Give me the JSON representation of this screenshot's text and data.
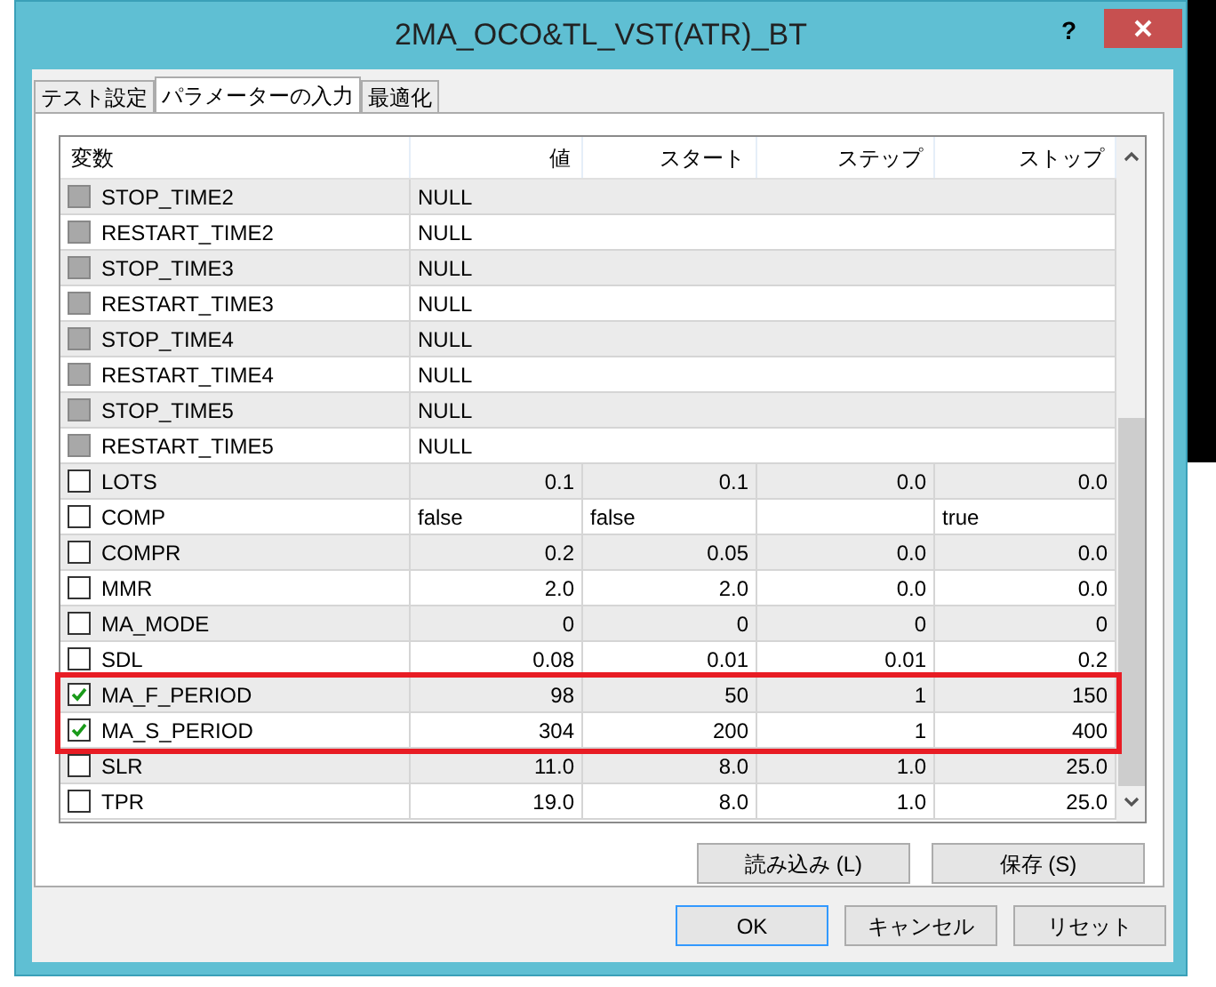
{
  "window": {
    "title": "2MA_OCO&TL_VST(ATR)_BT",
    "help": "?"
  },
  "tabs": [
    {
      "label": "テスト設定",
      "selected": false
    },
    {
      "label": "パラメーターの入力",
      "selected": true
    },
    {
      "label": "最適化",
      "selected": false
    }
  ],
  "table": {
    "columns": [
      "変数",
      "値",
      "スタート",
      "ステップ",
      "ストップ"
    ],
    "rows": [
      {
        "kind": "string",
        "name": "STOP_TIME2",
        "value": "NULL",
        "checked": false,
        "disabled": true,
        "highlighted": false
      },
      {
        "kind": "string",
        "name": "RESTART_TIME2",
        "value": "NULL",
        "checked": false,
        "disabled": true,
        "highlighted": false
      },
      {
        "kind": "string",
        "name": "STOP_TIME3",
        "value": "NULL",
        "checked": false,
        "disabled": true,
        "highlighted": false
      },
      {
        "kind": "string",
        "name": "RESTART_TIME3",
        "value": "NULL",
        "checked": false,
        "disabled": true,
        "highlighted": false
      },
      {
        "kind": "string",
        "name": "STOP_TIME4",
        "value": "NULL",
        "checked": false,
        "disabled": true,
        "highlighted": false
      },
      {
        "kind": "string",
        "name": "RESTART_TIME4",
        "value": "NULL",
        "checked": false,
        "disabled": true,
        "highlighted": false
      },
      {
        "kind": "string",
        "name": "STOP_TIME5",
        "value": "NULL",
        "checked": false,
        "disabled": true,
        "highlighted": false
      },
      {
        "kind": "string",
        "name": "RESTART_TIME5",
        "value": "NULL",
        "checked": false,
        "disabled": true,
        "highlighted": false
      },
      {
        "kind": "number",
        "name": "LOTS",
        "value": "0.1",
        "start": "0.1",
        "step": "0.0",
        "stop": "0.0",
        "checked": false,
        "disabled": false,
        "highlighted": false
      },
      {
        "kind": "bool",
        "name": "COMP",
        "value": "false",
        "start": "false",
        "stop": "true",
        "checked": false,
        "disabled": false,
        "highlighted": false
      },
      {
        "kind": "number",
        "name": "COMPR",
        "value": "0.2",
        "start": "0.05",
        "step": "0.0",
        "stop": "0.0",
        "checked": false,
        "disabled": false,
        "highlighted": false
      },
      {
        "kind": "number",
        "name": "MMR",
        "value": "2.0",
        "start": "2.0",
        "step": "0.0",
        "stop": "0.0",
        "checked": false,
        "disabled": false,
        "highlighted": false
      },
      {
        "kind": "number",
        "name": "MA_MODE",
        "value": "0",
        "start": "0",
        "step": "0",
        "stop": "0",
        "checked": false,
        "disabled": false,
        "highlighted": false
      },
      {
        "kind": "number",
        "name": "SDL",
        "value": "0.08",
        "start": "0.01",
        "step": "0.01",
        "stop": "0.2",
        "checked": false,
        "disabled": false,
        "highlighted": false
      },
      {
        "kind": "number",
        "name": "MA_F_PERIOD",
        "value": "98",
        "start": "50",
        "step": "1",
        "stop": "150",
        "checked": true,
        "disabled": false,
        "highlighted": true
      },
      {
        "kind": "number",
        "name": "MA_S_PERIOD",
        "value": "304",
        "start": "200",
        "step": "1",
        "stop": "400",
        "checked": true,
        "disabled": false,
        "highlighted": true
      },
      {
        "kind": "number",
        "name": "SLR",
        "value": "11.0",
        "start": "8.0",
        "step": "1.0",
        "stop": "25.0",
        "checked": false,
        "disabled": false,
        "highlighted": false
      },
      {
        "kind": "number",
        "name": "TPR",
        "value": "19.0",
        "start": "8.0",
        "step": "1.0",
        "stop": "25.0",
        "checked": false,
        "disabled": false,
        "highlighted": false
      }
    ]
  },
  "panel_buttons": [
    "読み込み (L)",
    "保存 (S)"
  ],
  "dialog_buttons": [
    {
      "label": "OK",
      "default": true
    },
    {
      "label": "キャンセル",
      "default": false
    },
    {
      "label": "リセット",
      "default": false
    }
  ]
}
